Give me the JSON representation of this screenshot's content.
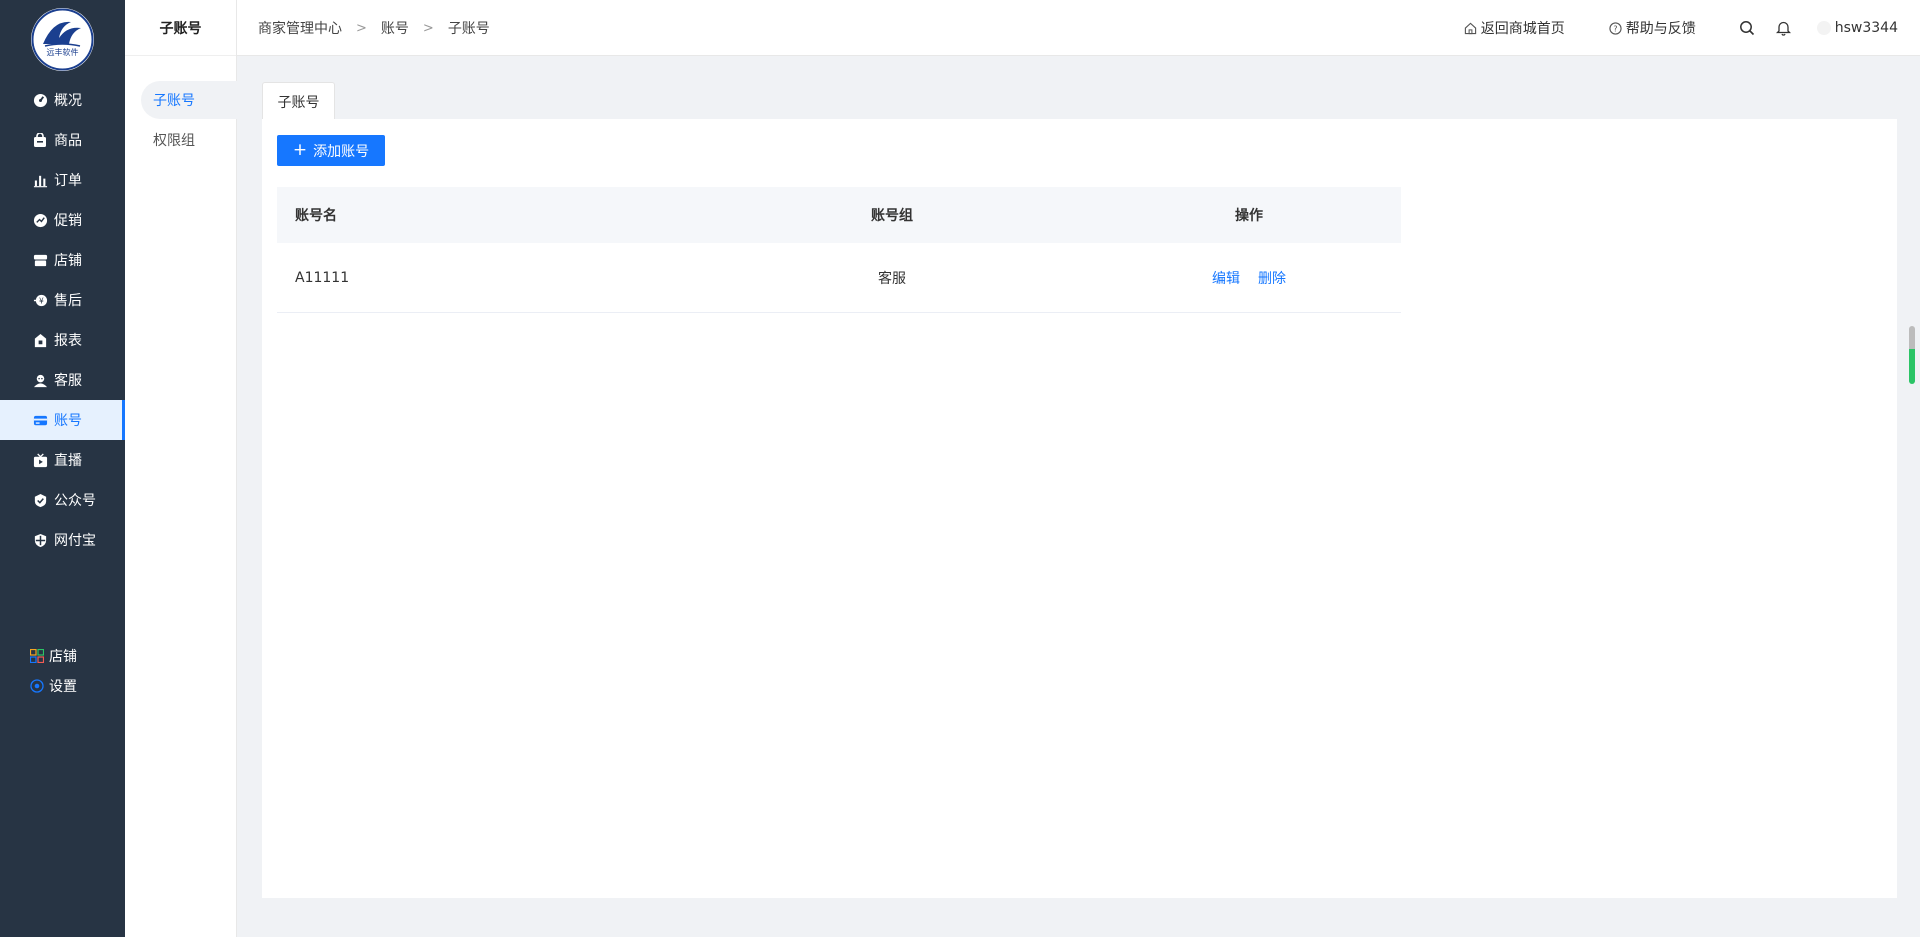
{
  "logo": {
    "text": "远丰软件"
  },
  "nav": {
    "items": [
      {
        "label": "概况",
        "icon": "dashboard-icon"
      },
      {
        "label": "商品",
        "icon": "goods-bag-icon"
      },
      {
        "label": "订单",
        "icon": "bar-chart-icon"
      },
      {
        "label": "促销",
        "icon": "promotion-icon"
      },
      {
        "label": "店铺",
        "icon": "store-icon"
      },
      {
        "label": "售后",
        "icon": "after-sale-icon"
      },
      {
        "label": "报表",
        "icon": "report-icon"
      },
      {
        "label": "客服",
        "icon": "customer-service-icon"
      },
      {
        "label": "账号",
        "icon": "account-card-icon",
        "active": true
      },
      {
        "label": "直播",
        "icon": "live-tv-icon"
      },
      {
        "label": "公众号",
        "icon": "official-account-icon"
      },
      {
        "label": "网付宝",
        "icon": "shield-pay-icon"
      }
    ],
    "bottom": [
      {
        "label": "店铺",
        "icon": "grid-apps-icon"
      },
      {
        "label": "设置",
        "icon": "settings-icon"
      }
    ],
    "active_color": "#1677ff",
    "bg_color": "#273444"
  },
  "subnav": {
    "title": "子账号",
    "items": [
      {
        "label": "子账号",
        "active": true
      },
      {
        "label": "权限组"
      }
    ]
  },
  "header": {
    "breadcrumb": [
      "商家管理中心",
      "账号",
      "子账号"
    ],
    "breadcrumb_separator": ">",
    "back_home": "返回商城首页",
    "help": "帮助与反馈",
    "username": "hsw3344"
  },
  "main": {
    "tab": "子账号",
    "add_button": "添加账号",
    "add_button_plus": "+",
    "table": {
      "columns": [
        "账号名",
        "账号组",
        "操作"
      ],
      "rows": [
        {
          "name": "A11111",
          "group": "客服",
          "actions": [
            "编辑",
            "删除"
          ]
        }
      ]
    }
  }
}
